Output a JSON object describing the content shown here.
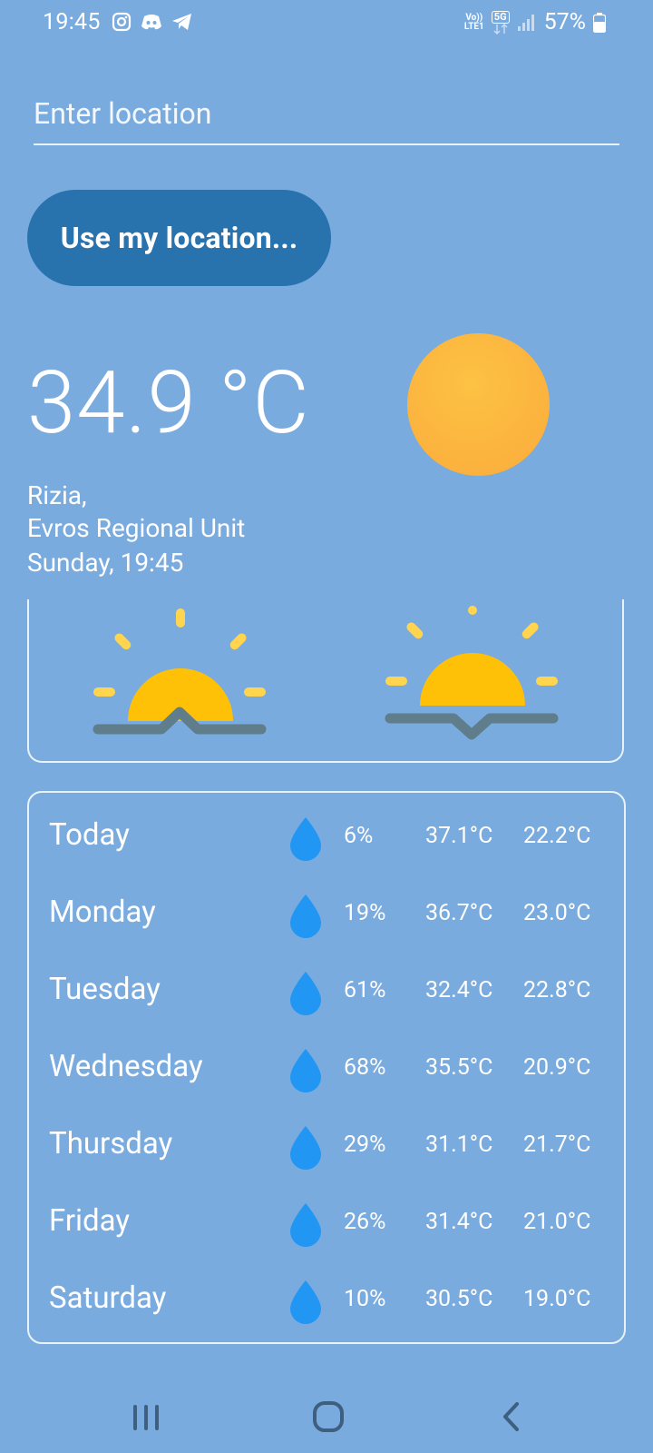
{
  "status_bar": {
    "time": "19:45",
    "network_top": "Vo))",
    "network_bottom": "LTE1",
    "network_5g": "5G",
    "battery": "57%"
  },
  "search": {
    "placeholder": "Enter location"
  },
  "use_location_label": "Use my location...",
  "current": {
    "temperature": "34.9 °C",
    "city": "Rizia,",
    "region": "Evros Regional Unit",
    "datetime": "Sunday, 19:45",
    "condition_icon": "sun-icon"
  },
  "sun_times": {
    "sunrise_icon": "sunrise-icon",
    "sunset_icon": "sunset-icon"
  },
  "forecast": [
    {
      "day": "Today",
      "rain": "6%",
      "max": "37.1°C",
      "min": "22.2°C"
    },
    {
      "day": "Monday",
      "rain": "19%",
      "max": "36.7°C",
      "min": "23.0°C"
    },
    {
      "day": "Tuesday",
      "rain": "61%",
      "max": "32.4°C",
      "min": "22.8°C"
    },
    {
      "day": "Wednesday",
      "rain": "68%",
      "max": "35.5°C",
      "min": "20.9°C"
    },
    {
      "day": "Thursday",
      "rain": "29%",
      "max": "31.1°C",
      "min": "21.7°C"
    },
    {
      "day": "Friday",
      "rain": "26%",
      "max": "31.4°C",
      "min": "21.0°C"
    },
    {
      "day": "Saturday",
      "rain": "10%",
      "max": "30.5°C",
      "min": "19.0°C"
    }
  ],
  "colors": {
    "background": "#79ABDF",
    "button": "#2872AE",
    "sun": "#FBB23E",
    "sun_icon": "#FFC107",
    "ray": "#FFD54F",
    "horizon": "#607D8B",
    "drop": "#2196F3"
  }
}
